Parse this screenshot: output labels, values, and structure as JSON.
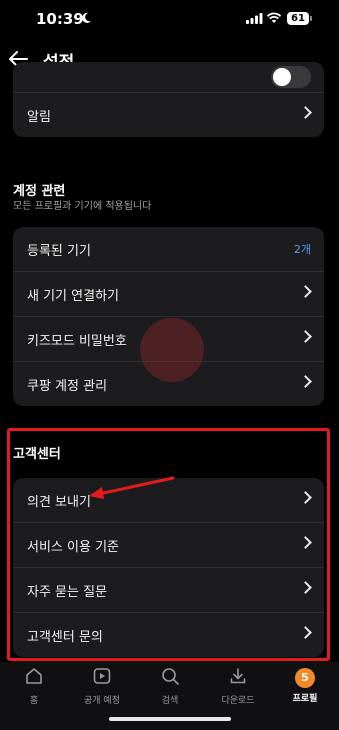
{
  "status_bar": {
    "time": "10:39",
    "battery": "61"
  },
  "header": {
    "title": "설정"
  },
  "top_card": {
    "items": [
      {
        "label": "알림"
      }
    ]
  },
  "account_section": {
    "title": "계정 관련",
    "subtitle": "모든 프로필과 기기에 적용됩니다",
    "items": [
      {
        "label": "등록된 기기",
        "value": "2개"
      },
      {
        "label": "새 기기 연결하기"
      },
      {
        "label": "키즈모드 비밀번호"
      },
      {
        "label": "쿠팡 계정 관리"
      }
    ]
  },
  "support_section": {
    "title": "고객센터",
    "items": [
      {
        "label": "의견 보내기"
      },
      {
        "label": "서비스 이용 기준"
      },
      {
        "label": "자주 묻는 질문"
      },
      {
        "label": "고객센터 문의"
      }
    ]
  },
  "tab_bar": {
    "items": [
      {
        "label": "홈",
        "icon": "home-icon"
      },
      {
        "label": "공개 예정",
        "icon": "play-icon"
      },
      {
        "label": "검색",
        "icon": "search-icon"
      },
      {
        "label": "다운로드",
        "icon": "download-icon"
      },
      {
        "label": "프로필",
        "icon": "profile-avatar",
        "badge": "5",
        "active": true
      }
    ]
  },
  "colors": {
    "accent": "#5b9bf0",
    "highlight": "#e41b1b",
    "badge": "#f28a2a"
  }
}
